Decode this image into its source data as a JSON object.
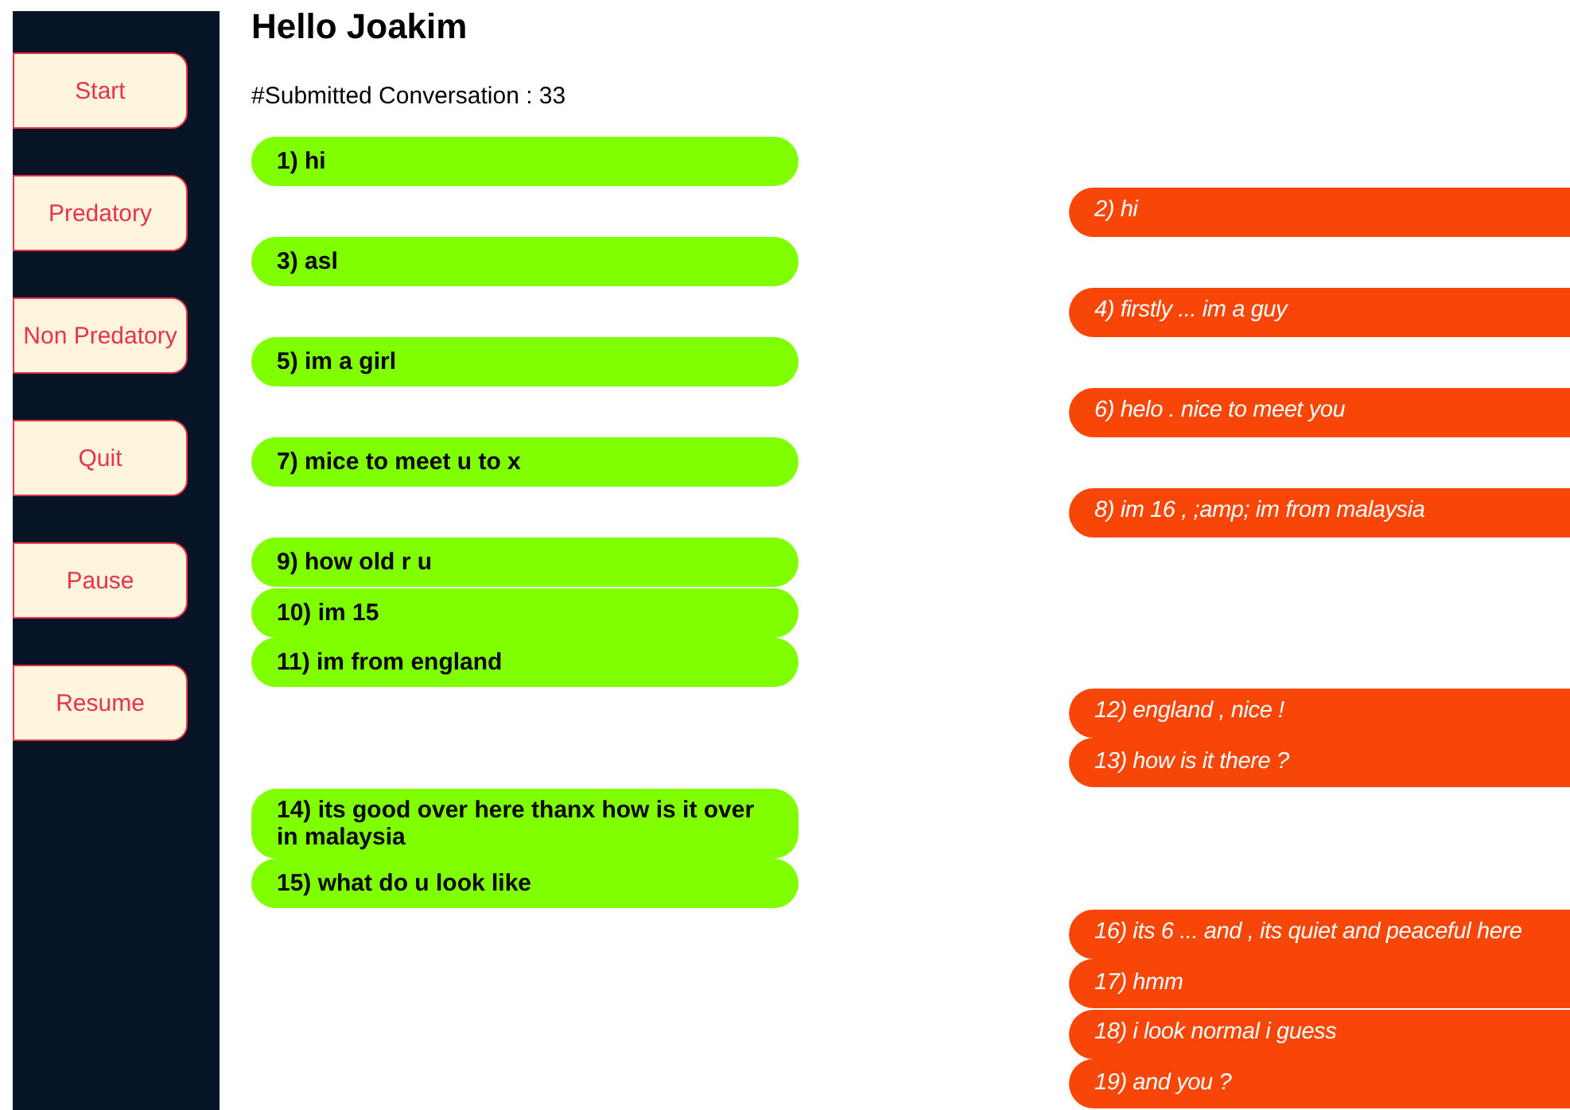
{
  "sidebar": {
    "buttons": [
      "Start",
      "Predatory",
      "Non Predatory",
      "Quit",
      "Pause",
      "Resume"
    ]
  },
  "greeting": "Hello Joakim",
  "submitted": "#Submitted Conversation : 33",
  "messages": [
    {
      "kind": "left",
      "text": "1) hi"
    },
    {
      "kind": "right",
      "text": "2) hi"
    },
    {
      "kind": "left",
      "text": "3) asl"
    },
    {
      "kind": "right",
      "text": "4) firstly ... im a guy"
    },
    {
      "kind": "left",
      "text": "5) im a girl"
    },
    {
      "kind": "right",
      "text": "6) helo . nice to meet you"
    },
    {
      "kind": "left",
      "text": "7) mice to meet u to x"
    },
    {
      "kind": "right",
      "text": "8) im 16 , ;amp; im from malaysia"
    },
    {
      "kind": "left",
      "text": "9) how old r u"
    },
    {
      "kind": "left",
      "text": "10) im 15"
    },
    {
      "kind": "left",
      "text": "11) im from england"
    },
    {
      "kind": "right",
      "text": "12) england , nice !"
    },
    {
      "kind": "right",
      "text": "13) how is it there ?"
    },
    {
      "kind": "left",
      "text": "14) its good over here thanx how is it over in malaysia"
    },
    {
      "kind": "left",
      "text": "15) what do u look like"
    },
    {
      "kind": "right",
      "text": "16) its 6 ... and , its quiet and peaceful here"
    },
    {
      "kind": "right",
      "text": "17) hmm"
    },
    {
      "kind": "right",
      "text": "18) i look normal i guess"
    },
    {
      "kind": "right",
      "text": "19) and you ?"
    }
  ]
}
